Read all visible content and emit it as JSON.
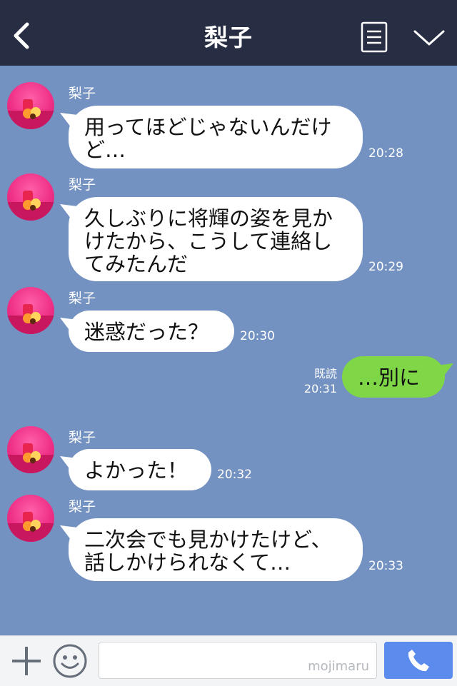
{
  "header": {
    "title": "梨子",
    "back_icon": "chevron-left-icon",
    "menu_icon": "menu-icon",
    "collapse_icon": "chevron-down-icon"
  },
  "messages": [
    {
      "sender": "梨子",
      "text": "用ってほどじゃないんだけ\nど…",
      "time": "20:28"
    },
    {
      "sender": "梨子",
      "text": "久しぶりに将輝の姿を見か\nけたから、こうして連絡し\nてみたんだ",
      "time": "20:29"
    },
    {
      "sender": "梨子",
      "text": "迷惑だった？",
      "time": "20:30"
    },
    {
      "sender": "",
      "text": "…別に",
      "time": "20:31",
      "read_label": "既読"
    },
    {
      "sender": "梨子",
      "text": "よかった！",
      "time": "20:32"
    },
    {
      "sender": "梨子",
      "text": "二次会でも見かけたけど、\n話しかけられなくて…",
      "time": "20:33"
    }
  ],
  "input_bar": {
    "watermark": "mojimaru",
    "plus_icon": "plus-icon",
    "emoji_icon": "smiley-icon",
    "send_icon": "phone-icon"
  },
  "colors": {
    "background": "#7392c1",
    "header": "#272d42",
    "own_bubble": "#7fd747",
    "send_button": "#5b8bec"
  }
}
